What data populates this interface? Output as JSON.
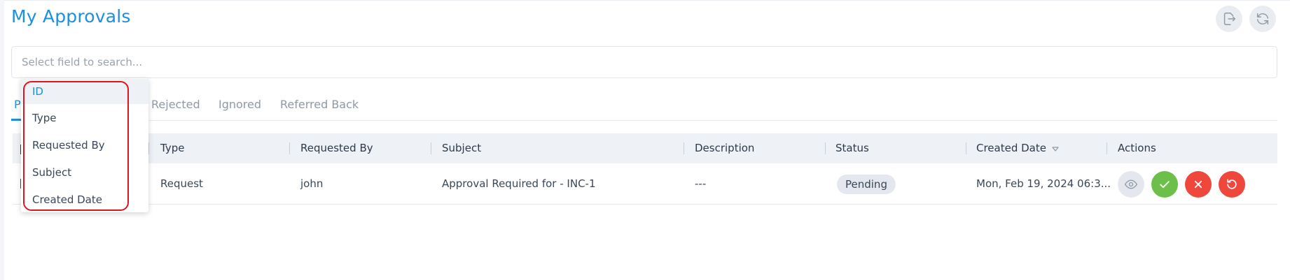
{
  "page": {
    "title": "My Approvals"
  },
  "header_actions": {
    "export_icon": "export-icon",
    "refresh_icon": "refresh-icon"
  },
  "search": {
    "placeholder": "Select field to search..."
  },
  "tabs": [
    {
      "label": "P",
      "active": true
    },
    {
      "label": "Rejected",
      "active": false
    },
    {
      "label": "Ignored",
      "active": false
    },
    {
      "label": "Referred Back",
      "active": false
    }
  ],
  "table": {
    "columns": [
      "Type",
      "Requested By",
      "Subject",
      "Description",
      "Status",
      "Created Date",
      "Actions"
    ],
    "rows": [
      {
        "type": "Request",
        "requested_by": "john",
        "subject": "Approval Required for - INC-1",
        "description": "---",
        "status": "Pending",
        "created_date": "Mon, Feb 19, 2024 06:3..."
      }
    ]
  },
  "row_actions": {
    "view_icon": "eye-icon",
    "approve_icon": "check-icon",
    "reject_icon": "close-icon",
    "refer_back_icon": "undo-icon"
  },
  "dropdown": {
    "items": [
      "ID",
      "Type",
      "Requested By",
      "Subject",
      "Created Date"
    ],
    "hovered_index": 0
  },
  "colors": {
    "accent": "#1e8fde",
    "approve": "#6cc04a",
    "reject": "#f0473d",
    "highlight": "#e0141e"
  }
}
